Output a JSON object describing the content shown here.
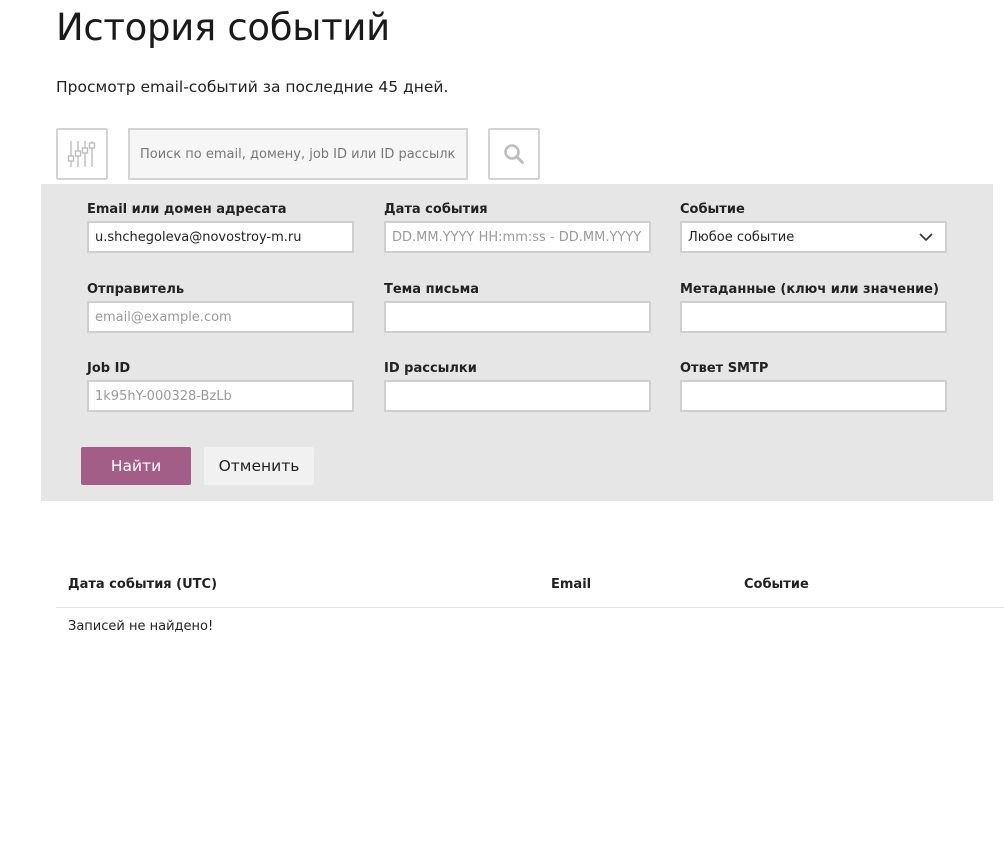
{
  "page": {
    "title": "История событий",
    "subtitle": "Просмотр email-событий за последние 45 дней."
  },
  "toolbar": {
    "filters_icon": "sliders-icon",
    "search_placeholder": "Поиск по email, домену, job ID или ID рассылки",
    "search_value": "",
    "search_icon": "search-icon"
  },
  "filters": {
    "recipient": {
      "label": "Email или домен адресата",
      "value": "u.shchegoleva@novostroy-m.ru",
      "placeholder": ""
    },
    "event_date": {
      "label": "Дата события",
      "value": "",
      "placeholder": "DD.MM.YYYY HH:mm:ss - DD.MM.YYYY HH:mm:ss"
    },
    "event": {
      "label": "Событие",
      "selected": "Любое событие"
    },
    "sender": {
      "label": "Отправитель",
      "value": "",
      "placeholder": "email@example.com"
    },
    "subject": {
      "label": "Тема письма",
      "value": "",
      "placeholder": ""
    },
    "metadata": {
      "label": "Метаданные (ключ или значение)",
      "value": "",
      "placeholder": ""
    },
    "job_id": {
      "label": "Job ID",
      "value": "",
      "placeholder": "1k95hY-000328-BzLb"
    },
    "campaign_id": {
      "label": "ID рассылки",
      "value": "",
      "placeholder": ""
    },
    "smtp_response": {
      "label": "Ответ SMTP",
      "value": "",
      "placeholder": ""
    }
  },
  "actions": {
    "submit_label": "Найти",
    "cancel_label": "Отменить"
  },
  "colors": {
    "accent": "#a35e87",
    "panel_bg": "#e6e6e6"
  },
  "results": {
    "columns": [
      "Дата события (UTC)",
      "Email",
      "Событие"
    ],
    "empty_message": "Записей не найдено!"
  }
}
